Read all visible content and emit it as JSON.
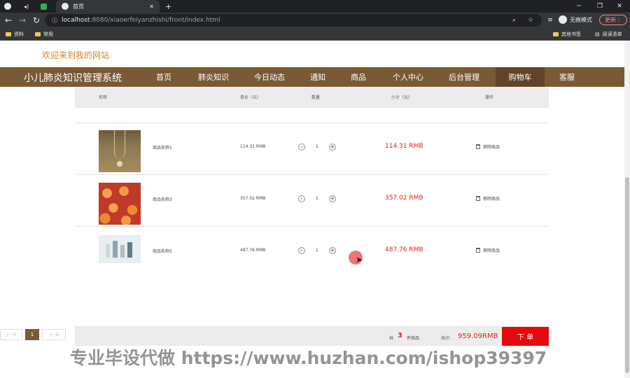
{
  "browser": {
    "tab_title": "首页",
    "new_tab": "+",
    "url_host": "localhost",
    "url_path": ":8080/xiaoerfeiyanzhishi/front/index.html",
    "incognito_label": "无痕模式",
    "update_label": "更新",
    "bookmarks": [
      "资料",
      "常用"
    ],
    "bookmarks_right": [
      "其他书签",
      "阅读清单"
    ]
  },
  "site": {
    "welcome": "欢迎来到我的网站",
    "title": "小儿肺炎知识管理系统",
    "nav": [
      "首页",
      "肺炎知识",
      "今日动态",
      "通知",
      "商品",
      "个人中心",
      "后台管理",
      "购物车",
      "客服"
    ],
    "active_nav": "购物车"
  },
  "cart": {
    "headers": [
      "名称",
      "单价（元）",
      "数量",
      "小计（元）",
      "操作"
    ],
    "items": [
      {
        "name": "商品名称1",
        "unit_price": "114.31 RMB",
        "qty": "1",
        "subtotal": "114.31 RMB",
        "action": "移除商品"
      },
      {
        "name": "商品名称3",
        "unit_price": "357.02 RMB",
        "qty": "1",
        "subtotal": "357.02 RMB",
        "action": "移除商品"
      },
      {
        "name": "商品名称5",
        "unit_price": "487.76 RMB",
        "qty": "1",
        "subtotal": "487.76 RMB",
        "action": "移除商品"
      }
    ],
    "qty_minus": "-",
    "qty_plus": "+",
    "pager": {
      "prev": "上一页",
      "current": "1",
      "next": "下一页"
    },
    "summary": {
      "prefix": "共",
      "count": "3",
      "suffix": "件商品",
      "total_label": "共计:",
      "total": "959.09RMB"
    },
    "order_button": "下 单"
  },
  "watermark": "专业毕设代做 https://www.huzhan.com/ishop39397",
  "colors": {
    "nav_bg": "#7a5a35",
    "accent_red": "#e8080d",
    "welcome": "#d6862b"
  }
}
